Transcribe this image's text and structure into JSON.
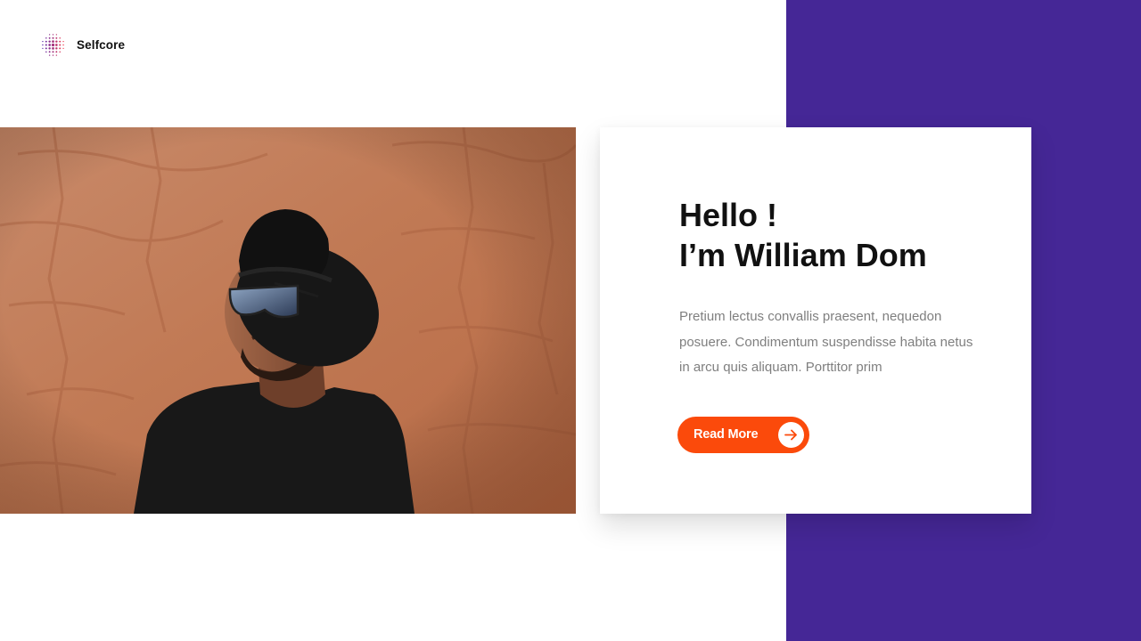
{
  "brand": {
    "name": "Selfcore",
    "logo_icon": "dot-grid-logo-icon"
  },
  "hero": {
    "greeting": "Hello !",
    "name_line": "I’m William Dom",
    "description": "Pretium lectus convallis praesent, nequedon posuere. Condimentum suspendisse habita netus in arcu quis aliquam. Porttitor prim",
    "cta_label": "Read More",
    "cta_icon": "arrow-right-icon",
    "photo_subject": "portrait-photo"
  },
  "colors": {
    "accent_orange": "#fb4a0b",
    "panel_purple": "#452796",
    "heading_text": "#111111",
    "body_text": "#7f7f7f"
  }
}
